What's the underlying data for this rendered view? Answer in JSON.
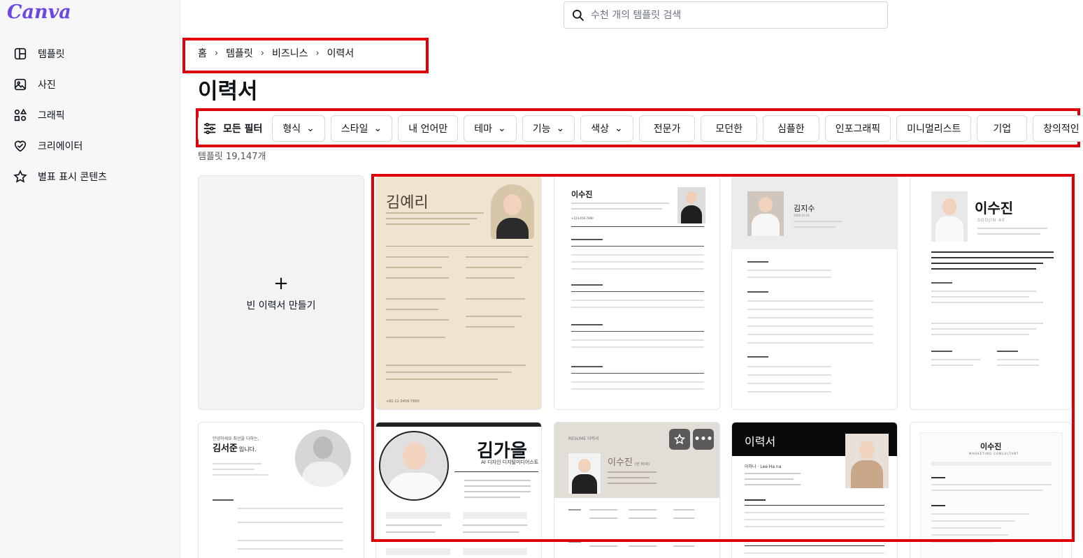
{
  "app": {
    "logo": "Canva"
  },
  "sidebar": {
    "items": [
      {
        "label": "템플릿",
        "icon": "template-icon"
      },
      {
        "label": "사진",
        "icon": "photo-icon"
      },
      {
        "label": "그래픽",
        "icon": "shapes-icon"
      },
      {
        "label": "크리에이터",
        "icon": "heart-creator-icon"
      },
      {
        "label": "별표 표시 콘텐츠",
        "icon": "star-icon"
      }
    ]
  },
  "search": {
    "placeholder": "수천 개의 템플릿 검색"
  },
  "breadcrumb": [
    "홈",
    "템플릿",
    "비즈니스",
    "이력서"
  ],
  "page": {
    "title": "이력서",
    "count": "템플릿 19,147개"
  },
  "filters": {
    "all": "모든 필터",
    "chips": [
      "형식",
      "스타일",
      "내 언어만",
      "테마",
      "기능",
      "색상",
      "전문가",
      "모던한",
      "심플한",
      "인포그래픽",
      "미니멀리스트",
      "기업",
      "창의적인"
    ]
  },
  "blank_card": {
    "label": "빈 이력서 만들기"
  },
  "templates": [
    {
      "name": "김예리",
      "footer": "+82-12-3456-7890"
    },
    {
      "name": "이수진",
      "sub": "+123-456-7890"
    },
    {
      "name": "김지수",
      "sub": "2000.01.01"
    },
    {
      "name": "이수진",
      "sub": "SOOJIN AE"
    },
    {
      "name": "김서준",
      "intro": "안녕하세요 최선을 다하는,",
      "suffix": "입니다."
    },
    {
      "name": "김가을",
      "sub": "AI 디자인 디지털미디어스트"
    },
    {
      "name": "이수진",
      "sub": "(만 30세)",
      "tag": "RESUME 이력서"
    },
    {
      "name": "이력서",
      "sub": "이하나 · Lee Ha na"
    },
    {
      "name": "이수진",
      "sub": "MARKETING CONSULTANT"
    }
  ]
}
